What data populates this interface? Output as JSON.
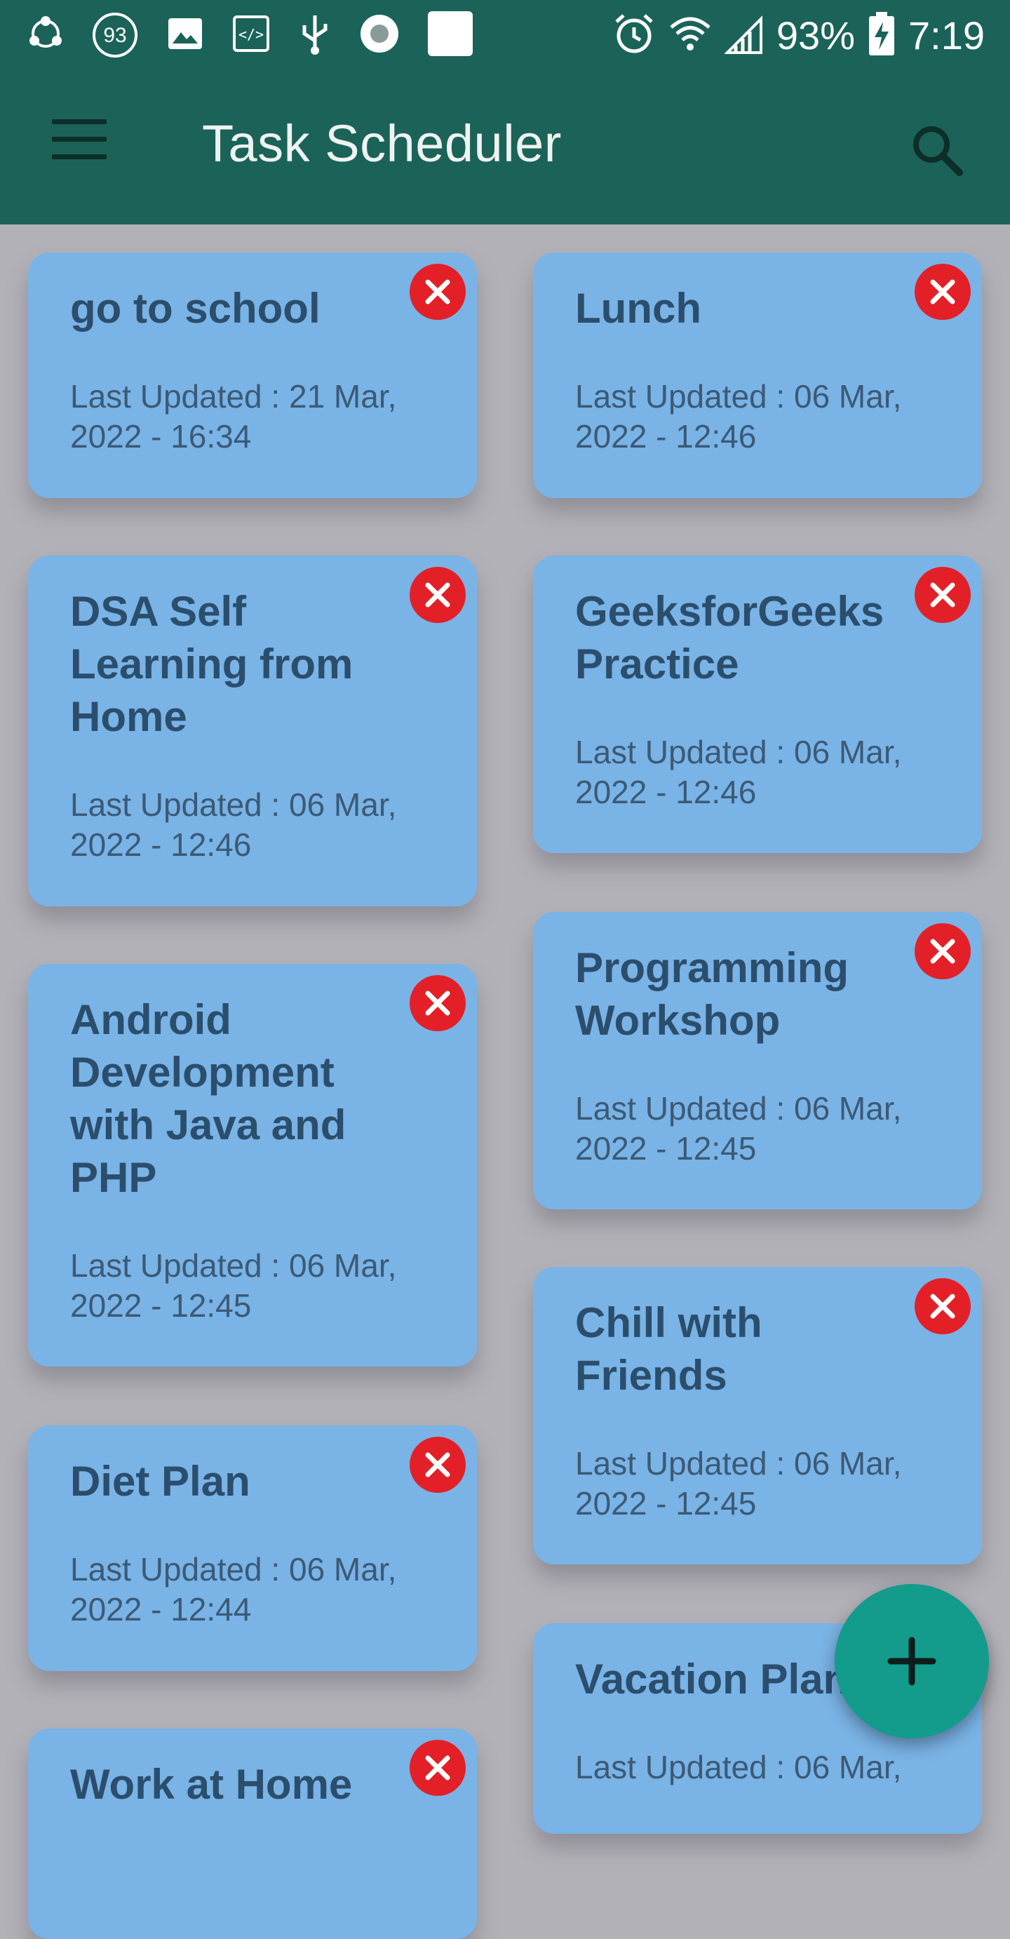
{
  "status_bar": {
    "notification_count": "93",
    "battery": "93%",
    "time": "7:19"
  },
  "app_bar": {
    "title": "Task Scheduler",
    "menu_icon": "hamburger-menu-icon",
    "search_icon": "search-icon"
  },
  "tasks": [
    {
      "title": "go to school",
      "updated": "Last Updated : 21 Mar, 2022 - 16:34"
    },
    {
      "title": "Lunch",
      "updated": "Last Updated : 06 Mar, 2022 - 12:46"
    },
    {
      "title": "DSA Self Learning from Home",
      "updated": "Last Updated : 06 Mar, 2022 - 12:46"
    },
    {
      "title": "GeeksforGeeks Practice",
      "updated": "Last Updated : 06 Mar, 2022 - 12:46"
    },
    {
      "title": "Android Development with Java and PHP",
      "updated": "Last Updated : 06 Mar, 2022 - 12:45"
    },
    {
      "title": "Programming Workshop",
      "updated": "Last Updated : 06 Mar, 2022 - 12:45"
    },
    {
      "title": "Chill with Friends",
      "updated": "Last Updated : 06 Mar, 2022 - 12:45"
    },
    {
      "title": "Diet Plan",
      "updated": "Last Updated : 06 Mar, 2022 - 12:44"
    },
    {
      "title": "Vacation Plan",
      "updated": "Last Updated : 06 Mar,"
    },
    {
      "title": "Work at Home",
      "updated": ""
    }
  ],
  "fab": {
    "icon": "plus-icon"
  },
  "colors": {
    "app_bar": "#1b6358",
    "card": "#7ab3e6",
    "delete": "#e32027",
    "fab": "#139b8b",
    "background": "#b3b1b8"
  }
}
